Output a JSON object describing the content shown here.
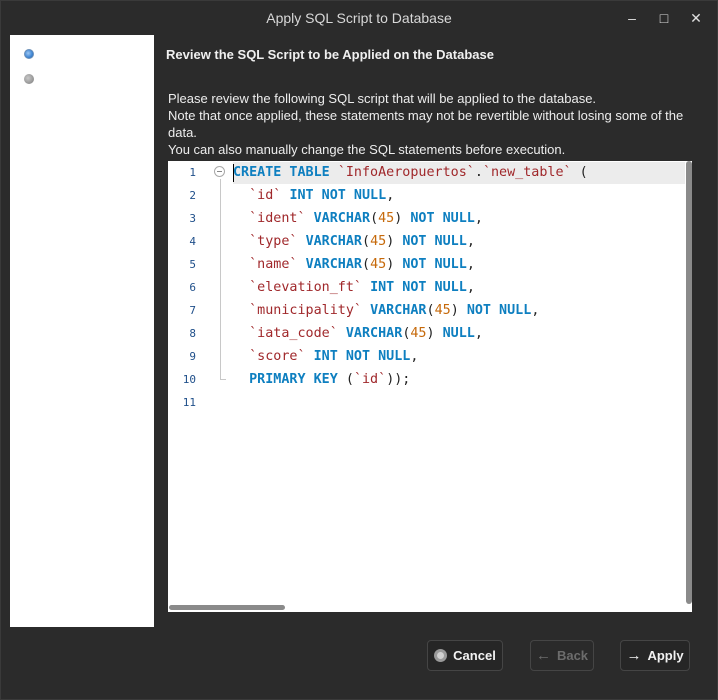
{
  "window": {
    "title": "Apply SQL Script to Database"
  },
  "heading": "Review the SQL Script to be Applied on the Database",
  "description": [
    "Please review the following SQL script that will be applied to the database.",
    "Note that once applied, these statements may not be revertible without losing some of the",
    "data.",
    "You can also manually change the SQL statements before execution."
  ],
  "line_numbers": [
    "1",
    "2",
    "3",
    "4",
    "5",
    "6",
    "7",
    "8",
    "9",
    "10",
    "11"
  ],
  "code_lines": [
    [
      [
        "kw",
        "CREATE TABLE"
      ],
      [
        "pun",
        " "
      ],
      [
        "id",
        "`InfoAeropuertos`"
      ],
      [
        "pun",
        "."
      ],
      [
        "id",
        "`new_table`"
      ],
      [
        "pun",
        " ("
      ]
    ],
    [
      [
        "pun",
        "  "
      ],
      [
        "id",
        "`id`"
      ],
      [
        "pun",
        " "
      ],
      [
        "kw",
        "INT NOT NULL"
      ],
      [
        "pun",
        ","
      ]
    ],
    [
      [
        "pun",
        "  "
      ],
      [
        "id",
        "`ident`"
      ],
      [
        "pun",
        " "
      ],
      [
        "kw",
        "VARCHAR"
      ],
      [
        "pun",
        "("
      ],
      [
        "num",
        "45"
      ],
      [
        "pun",
        ") "
      ],
      [
        "kw",
        "NOT NULL"
      ],
      [
        "pun",
        ","
      ]
    ],
    [
      [
        "pun",
        "  "
      ],
      [
        "id",
        "`type`"
      ],
      [
        "pun",
        " "
      ],
      [
        "kw",
        "VARCHAR"
      ],
      [
        "pun",
        "("
      ],
      [
        "num",
        "45"
      ],
      [
        "pun",
        ") "
      ],
      [
        "kw",
        "NOT NULL"
      ],
      [
        "pun",
        ","
      ]
    ],
    [
      [
        "pun",
        "  "
      ],
      [
        "id",
        "`name`"
      ],
      [
        "pun",
        " "
      ],
      [
        "kw",
        "VARCHAR"
      ],
      [
        "pun",
        "("
      ],
      [
        "num",
        "45"
      ],
      [
        "pun",
        ") "
      ],
      [
        "kw",
        "NOT NULL"
      ],
      [
        "pun",
        ","
      ]
    ],
    [
      [
        "pun",
        "  "
      ],
      [
        "id",
        "`elevation_ft`"
      ],
      [
        "pun",
        " "
      ],
      [
        "kw",
        "INT NOT NULL"
      ],
      [
        "pun",
        ","
      ]
    ],
    [
      [
        "pun",
        "  "
      ],
      [
        "id",
        "`municipality`"
      ],
      [
        "pun",
        " "
      ],
      [
        "kw",
        "VARCHAR"
      ],
      [
        "pun",
        "("
      ],
      [
        "num",
        "45"
      ],
      [
        "pun",
        ") "
      ],
      [
        "kw",
        "NOT NULL"
      ],
      [
        "pun",
        ","
      ]
    ],
    [
      [
        "pun",
        "  "
      ],
      [
        "id",
        "`iata_code`"
      ],
      [
        "pun",
        " "
      ],
      [
        "kw",
        "VARCHAR"
      ],
      [
        "pun",
        "("
      ],
      [
        "num",
        "45"
      ],
      [
        "pun",
        ") "
      ],
      [
        "kw",
        "NULL"
      ],
      [
        "pun",
        ","
      ]
    ],
    [
      [
        "pun",
        "  "
      ],
      [
        "id",
        "`score`"
      ],
      [
        "pun",
        " "
      ],
      [
        "kw",
        "INT NOT NULL"
      ],
      [
        "pun",
        ","
      ]
    ],
    [
      [
        "pun",
        "  "
      ],
      [
        "kw",
        "PRIMARY KEY"
      ],
      [
        "pun",
        " ("
      ],
      [
        "id",
        "`id`"
      ],
      [
        "pun",
        "));"
      ]
    ],
    []
  ],
  "buttons": {
    "cancel": "Cancel",
    "back": "Back",
    "apply": "Apply"
  },
  "colors": {
    "keyword": "#0e7fc0",
    "identifier": "#a0282b",
    "number": "#c6690a",
    "step_active": "#3f86d4"
  },
  "icons": {
    "minimize": "minimize-icon",
    "maximize": "maximize-icon",
    "close": "close-icon",
    "cancel": "cancel-icon",
    "back": "arrow-left-icon",
    "apply": "arrow-right-icon"
  }
}
